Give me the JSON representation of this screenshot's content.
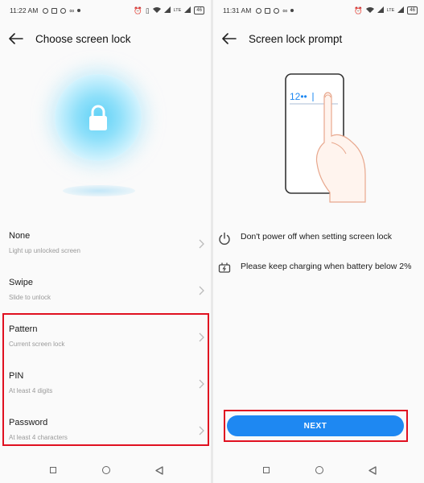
{
  "left": {
    "status": {
      "time": "11:22 AM",
      "signal_text": "LTE",
      "battery": "46"
    },
    "header": {
      "title": "Choose screen lock"
    },
    "options": [
      {
        "label": "None",
        "sub": "Light up unlocked screen"
      },
      {
        "label": "Swipe",
        "sub": "Slide to unlock"
      },
      {
        "label": "Pattern",
        "sub": "Current screen lock"
      },
      {
        "label": "PIN",
        "sub": "At least 4 digits"
      },
      {
        "label": "Password",
        "sub": "At least 4 characters"
      }
    ]
  },
  "right": {
    "status": {
      "time": "11:31 AM",
      "signal_text": "LTE",
      "battery": "46"
    },
    "header": {
      "title": "Screen lock prompt"
    },
    "illustration": {
      "pin_text": "12••"
    },
    "tips": [
      {
        "icon": "power-icon",
        "text": "Don't power off when setting screen lock"
      },
      {
        "icon": "charging-icon",
        "text": "Please keep charging when battery below 2%"
      }
    ],
    "next_label": "NEXT"
  },
  "colors": {
    "accent": "#1e88f2",
    "highlight": "#e01020",
    "orb": "#5fd1f6"
  }
}
